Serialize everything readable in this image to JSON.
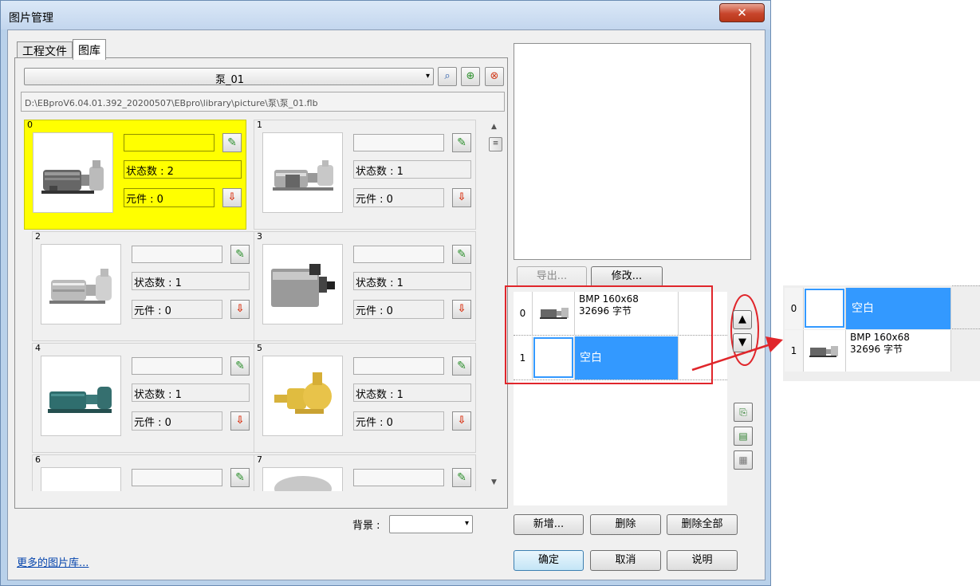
{
  "window": {
    "title": "图片管理",
    "close_glyph": "✕"
  },
  "tabs": [
    {
      "label": "工程文件"
    },
    {
      "label": "图库"
    }
  ],
  "library": {
    "selected": "泵_01",
    "path": "D:\\EBproV6.04.01.392_20200507\\EBpro\\library\\picture\\泵\\泵_01.flb"
  },
  "cards": [
    {
      "index": "0",
      "states": "状态数 : 2",
      "elements": "元件 : 0",
      "selected": true
    },
    {
      "index": "1",
      "states": "状态数 : 1",
      "elements": "元件 : 0"
    },
    {
      "index": "2",
      "states": "状态数 : 1",
      "elements": "元件 : 0"
    },
    {
      "index": "3",
      "states": "状态数 : 1",
      "elements": "元件 : 0"
    },
    {
      "index": "4",
      "states": "状态数 : 1",
      "elements": "元件 : 0"
    },
    {
      "index": "5",
      "states": "状态数 : 1",
      "elements": "元件 : 0"
    },
    {
      "index": "6",
      "states": "",
      "elements": ""
    },
    {
      "index": "7",
      "states": "",
      "elements": ""
    }
  ],
  "background": {
    "label": "背景 :"
  },
  "right": {
    "export_label": "导出...",
    "modify_label": "修改...",
    "states": [
      {
        "num": "0",
        "format": "BMP 160x68",
        "size": "32696 字节"
      },
      {
        "num": "1",
        "blank": "空白"
      }
    ]
  },
  "buttons": {
    "add": "新增...",
    "delete": "删除",
    "delete_all": "删除全部",
    "ok": "确定",
    "cancel": "取消",
    "help": "说明"
  },
  "more_libraries": "更多的图片库...",
  "reordered": [
    {
      "num": "0",
      "blank": "空白"
    },
    {
      "num": "1",
      "format": "BMP 160x68",
      "size": "32696 字节"
    }
  ],
  "colors": {
    "selection_yellow": "#ffff00",
    "selection_blue": "#3399ff",
    "highlight_red": "#e0262b"
  },
  "icons": {
    "edit": "pencil-icon",
    "delete": "delete-icon",
    "move_up": "triangle-up-icon",
    "move_down": "triangle-down-icon",
    "copy": "copy-icon",
    "paste": "paste-icon",
    "transparent": "checker-icon"
  }
}
